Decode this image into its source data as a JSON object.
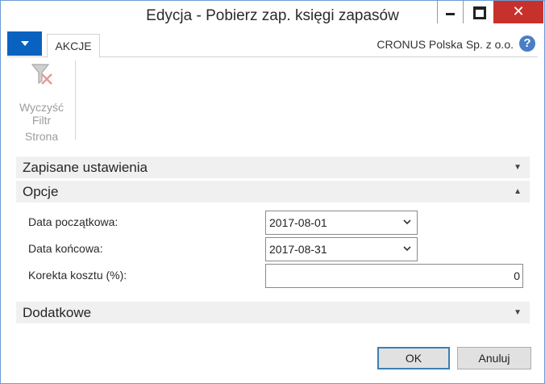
{
  "window": {
    "title": "Edycja - Pobierz zap. księgi zapasów",
    "controls": {
      "minimize": "minimize",
      "maximize": "maximize",
      "close": "✕"
    }
  },
  "ribbon": {
    "tab_label": "AKCJE",
    "company": "CRONUS Polska Sp. z o.o.",
    "help_label": "?",
    "clear_filter": {
      "line1": "Wyczyść",
      "line2": "Filtr",
      "icon": "clear-filter-icon"
    },
    "group_label": "Strona"
  },
  "sections": {
    "saved_settings": "Zapisane ustawienia",
    "options": "Opcje",
    "additional": "Dodatkowe"
  },
  "fields": {
    "start_date": {
      "label": "Data początkowa:",
      "value": "2017-08-01"
    },
    "end_date": {
      "label": "Data końcowa:",
      "value": "2017-08-31"
    },
    "cost_adjustment": {
      "label": "Korekta kosztu (%):",
      "value": "0"
    }
  },
  "buttons": {
    "ok": "OK",
    "cancel": "Anuluj"
  },
  "colors": {
    "app_menu": "#0a62c0",
    "close_button": "#c7312b",
    "section_bg": "#f0f0f0"
  }
}
